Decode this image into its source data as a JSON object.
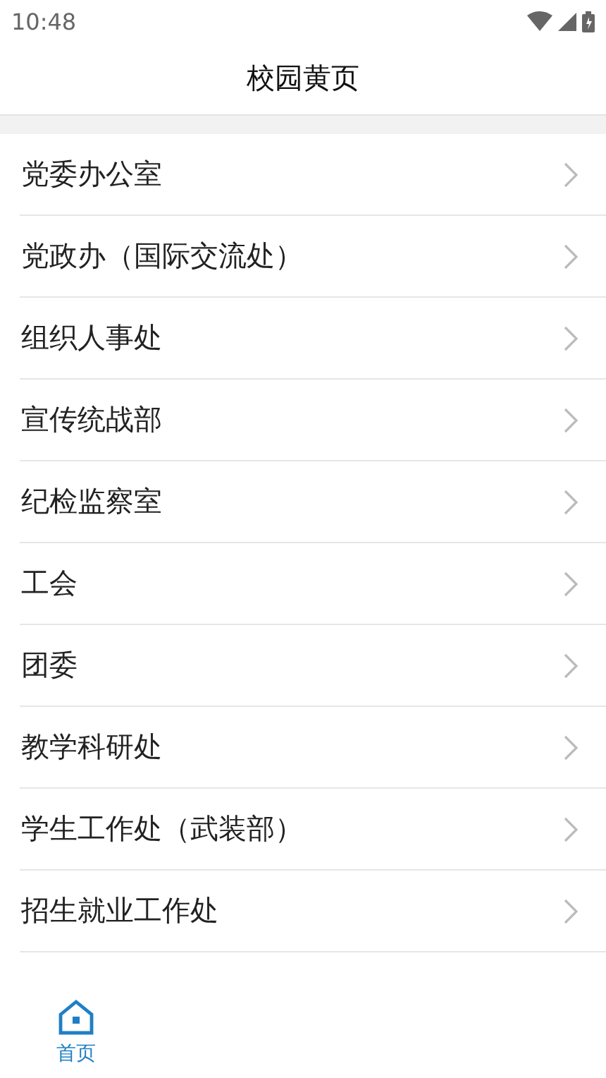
{
  "status_bar": {
    "time": "10:48"
  },
  "header": {
    "title": "校园黄页"
  },
  "departments": [
    {
      "name": "党委办公室"
    },
    {
      "name": "党政办（国际交流处）"
    },
    {
      "name": "组织人事处"
    },
    {
      "name": "宣传统战部"
    },
    {
      "name": "纪检监察室"
    },
    {
      "name": "工会"
    },
    {
      "name": "团委"
    },
    {
      "name": "教学科研处"
    },
    {
      "name": "学生工作处（武装部）"
    },
    {
      "name": "招生就业工作处"
    }
  ],
  "bottom_nav": [
    {
      "label": "首页",
      "selected": true
    }
  ]
}
